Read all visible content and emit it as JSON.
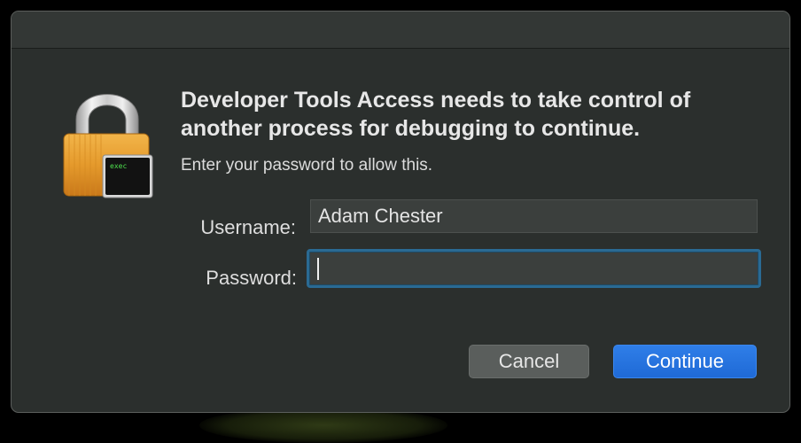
{
  "dialog": {
    "heading": "Developer Tools Access needs to take control of another process for debugging to continue.",
    "subtext": "Enter your password to allow this.",
    "icon": "lock-exec-icon",
    "icon_text": "exec"
  },
  "form": {
    "username_label": "Username:",
    "username_value": "Adam Chester",
    "password_label": "Password:",
    "password_value": ""
  },
  "buttons": {
    "cancel_label": "Cancel",
    "continue_label": "Continue"
  },
  "colors": {
    "dialog_bg": "#2b2f2d",
    "accent": "#2a7ae4",
    "focus_ring": "#2a6a93"
  }
}
